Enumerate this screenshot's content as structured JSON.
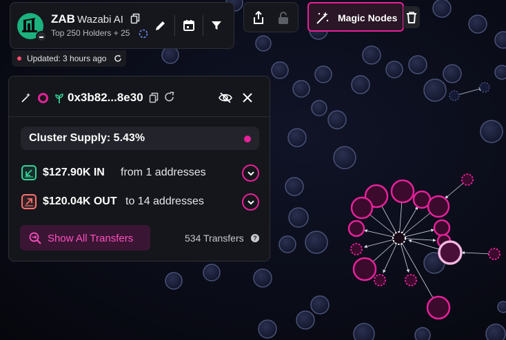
{
  "token": {
    "symbol": "ZAB",
    "name": "Wazabi AI",
    "subtitle": "Top 250 Holders + 25",
    "icon": "wazabi-logo"
  },
  "status": {
    "updated": "Updated: 3 hours ago",
    "dot_color": "#ff4d6d"
  },
  "toolbar": {
    "magic_nodes_label": "Magic Nodes",
    "accent": "#e7219a"
  },
  "cluster": {
    "address": "0x3b82...8e30",
    "supply_label": "Cluster Supply: 5.43%",
    "in_amount": "$127.90K IN",
    "in_desc": "from 1 addresses",
    "out_amount": "$120.04K OUT",
    "out_desc": "to 14 addresses",
    "show_transfers_label": "Show All Transfers",
    "transfer_count": "534 Transfers",
    "help": "?"
  },
  "colors": {
    "background": "#0a0c18",
    "node_fill": "#1b1f3a",
    "node_stroke": "#4a5378",
    "cluster_fill": "#3b0a2c",
    "cluster_stroke": "#e7219a",
    "in_color": "#34d399",
    "out_color": "#f87171"
  }
}
